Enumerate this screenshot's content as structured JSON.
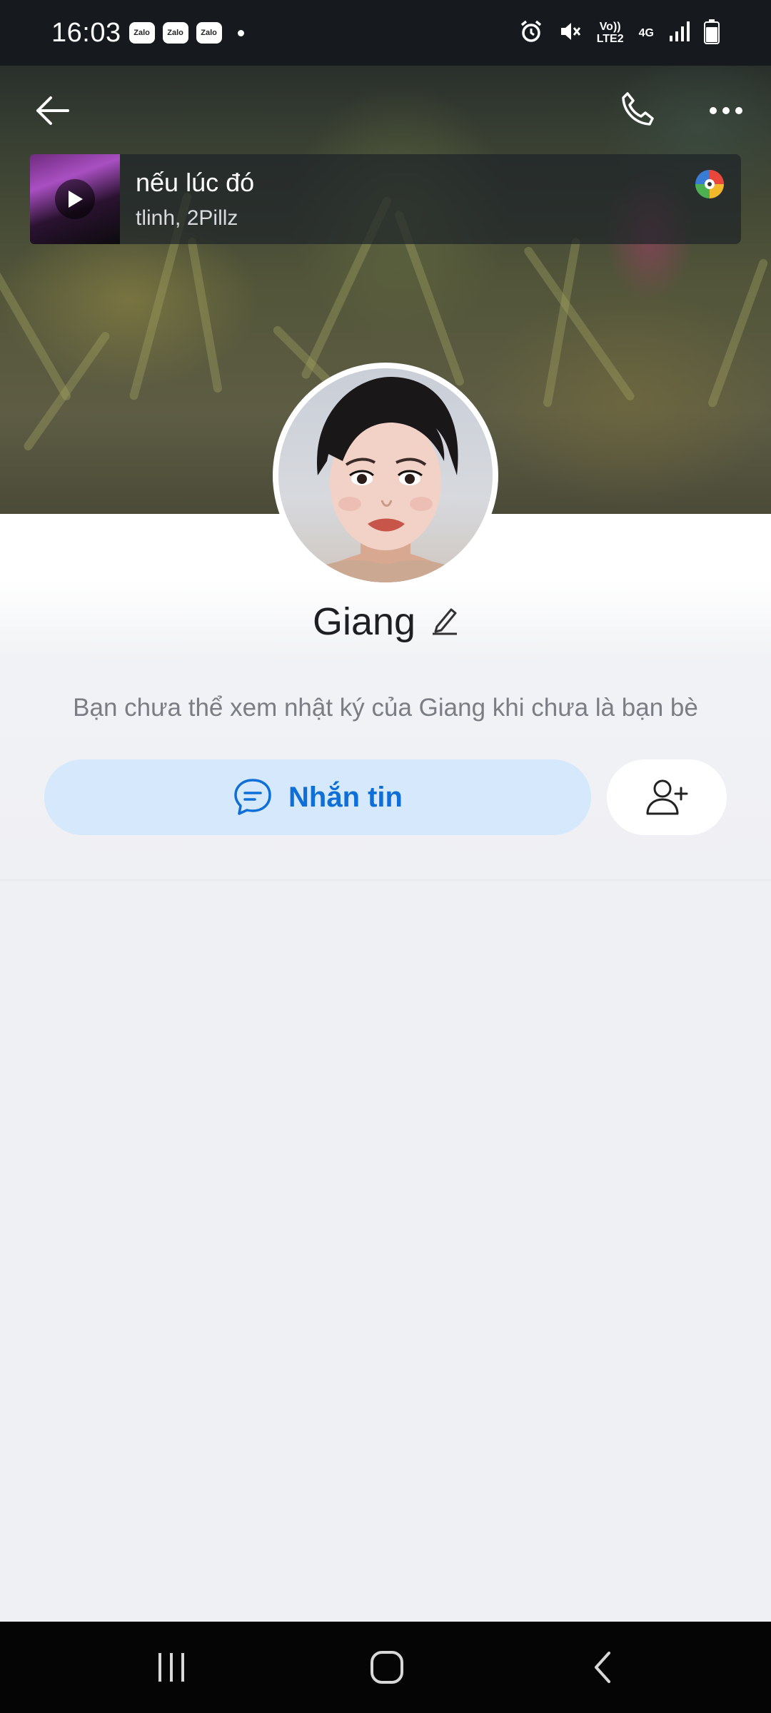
{
  "status_bar": {
    "time": "16:03",
    "notification_apps": [
      "Zalo",
      "Zalo",
      "Zalo"
    ],
    "network_volte": "Vo)) LTE2",
    "network_type": "4G",
    "icons": [
      "alarm-icon",
      "mute-icon",
      "signal-icon",
      "battery-icon"
    ]
  },
  "top_bar": {
    "icons": [
      "back-arrow-icon",
      "phone-icon",
      "more-dots-icon"
    ]
  },
  "music": {
    "title": "nếu lúc đó",
    "artist": "tlinh, 2Pillz"
  },
  "profile": {
    "name": "Giang",
    "note": "Bạn chưa thể xem nhật ký của Giang khi chưa là bạn bè"
  },
  "actions": {
    "message_label": "Nhắn tin"
  },
  "colors": {
    "accent": "#0f6fd8",
    "message_button_bg": "#d6e8fb",
    "page_bg": "#eff0f4"
  }
}
